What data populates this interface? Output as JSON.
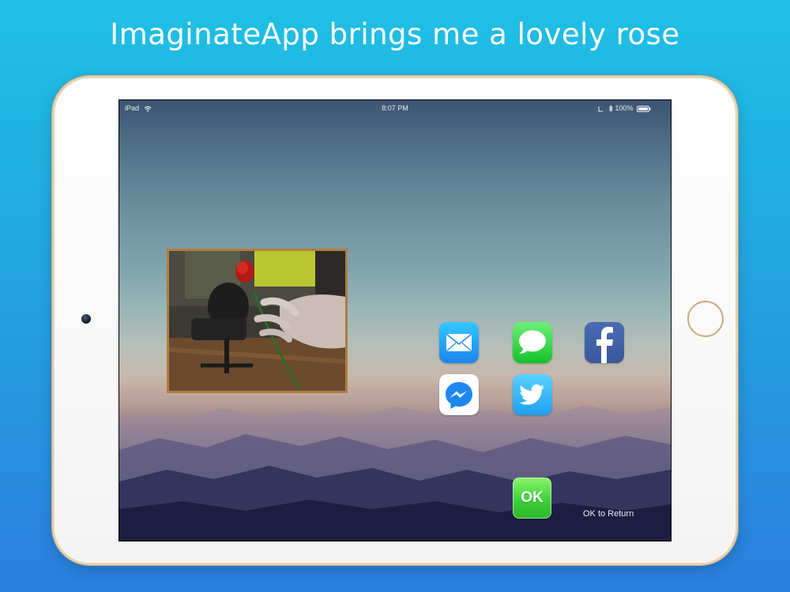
{
  "headline": "ImaginateApp brings me a lovely rose",
  "status_bar": {
    "device": "iPad",
    "time": "8:07 PM",
    "battery": "100%",
    "icons": [
      "wifi-icon",
      "location-icon",
      "bluetooth-icon",
      "battery-icon"
    ]
  },
  "photo": {
    "subject": "hand holding a red rose"
  },
  "share_icons": [
    "mail-icon",
    "messages-icon",
    "facebook-icon",
    "messenger-icon",
    "twitter-icon"
  ],
  "ok_button": {
    "label": "OK"
  },
  "ok_hint": "OK to Return",
  "colors": {
    "background_top": "#1fc0e4",
    "background_bottom": "#2b7fe0",
    "ipad_frame": "#c9ab82",
    "photo_border": "#b07d3c",
    "ok_green": "#3fd23a"
  }
}
